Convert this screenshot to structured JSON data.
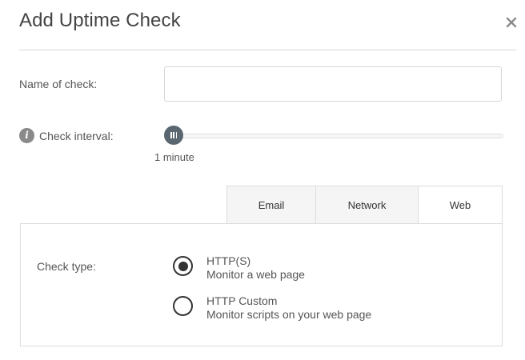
{
  "dialog": {
    "title": "Add Uptime Check"
  },
  "name_field": {
    "label": "Name of check:",
    "value": "",
    "placeholder": ""
  },
  "interval": {
    "label": "Check interval:",
    "value_text": "1 minute",
    "position_fraction": 0
  },
  "tabs": [
    {
      "label": "Email",
      "selected": false
    },
    {
      "label": "Network",
      "selected": false
    },
    {
      "label": "Web",
      "selected": true
    }
  ],
  "check_type": {
    "label": "Check type:",
    "options": [
      {
        "title": "HTTP(S)",
        "description": "Monitor a web page",
        "selected": true
      },
      {
        "title": "HTTP Custom",
        "description": "Monitor scripts on your web page",
        "selected": false
      }
    ]
  },
  "icons": {
    "close": "close-icon",
    "info": "info-icon"
  },
  "colors": {
    "slider_handle": "#5a6670",
    "radio": "#333333",
    "info_icon": "#8a8a8a"
  }
}
